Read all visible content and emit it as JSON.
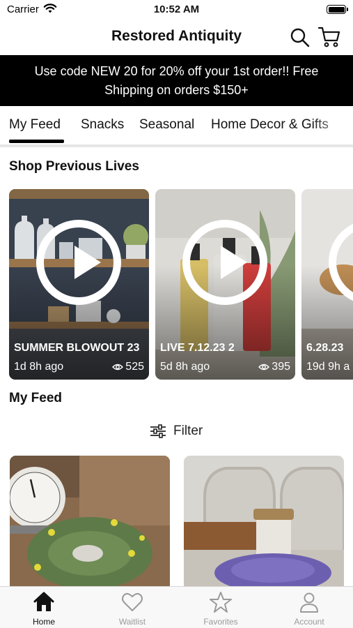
{
  "status_bar": {
    "carrier": "Carrier",
    "time": "10:52 AM"
  },
  "nav": {
    "title": "Restored Antiquity"
  },
  "promo": {
    "text": "Use code NEW 20 for 20% off your 1st order!! Free Shipping on orders $150+"
  },
  "tabs": [
    {
      "label": "My Feed",
      "selected": true
    },
    {
      "label": "Snacks"
    },
    {
      "label": "Seasonal"
    },
    {
      "label": "Home Decor & Gifts"
    }
  ],
  "previous_lives": {
    "title": "Shop Previous Lives",
    "items": [
      {
        "title": "SUMMER BLOWOUT 23",
        "ago": "1d 8h ago",
        "views": "525"
      },
      {
        "title": "LIVE 7.12.23 2",
        "ago": "5d 8h ago",
        "views": "395"
      },
      {
        "title": "6.28.23",
        "ago": "19d 9h a",
        "views": ""
      }
    ]
  },
  "feed": {
    "title": "My Feed",
    "filter_label": "Filter"
  },
  "tabbar": [
    {
      "label": "Home",
      "icon": "home-icon",
      "active": true
    },
    {
      "label": "Waitlist",
      "icon": "heart-icon"
    },
    {
      "label": "Favorites",
      "icon": "star-icon"
    },
    {
      "label": "Account",
      "icon": "person-icon"
    }
  ],
  "colors": {
    "banner_bg": "#000000",
    "text": "#111111",
    "tab_inactive": "#9a9a9a"
  }
}
